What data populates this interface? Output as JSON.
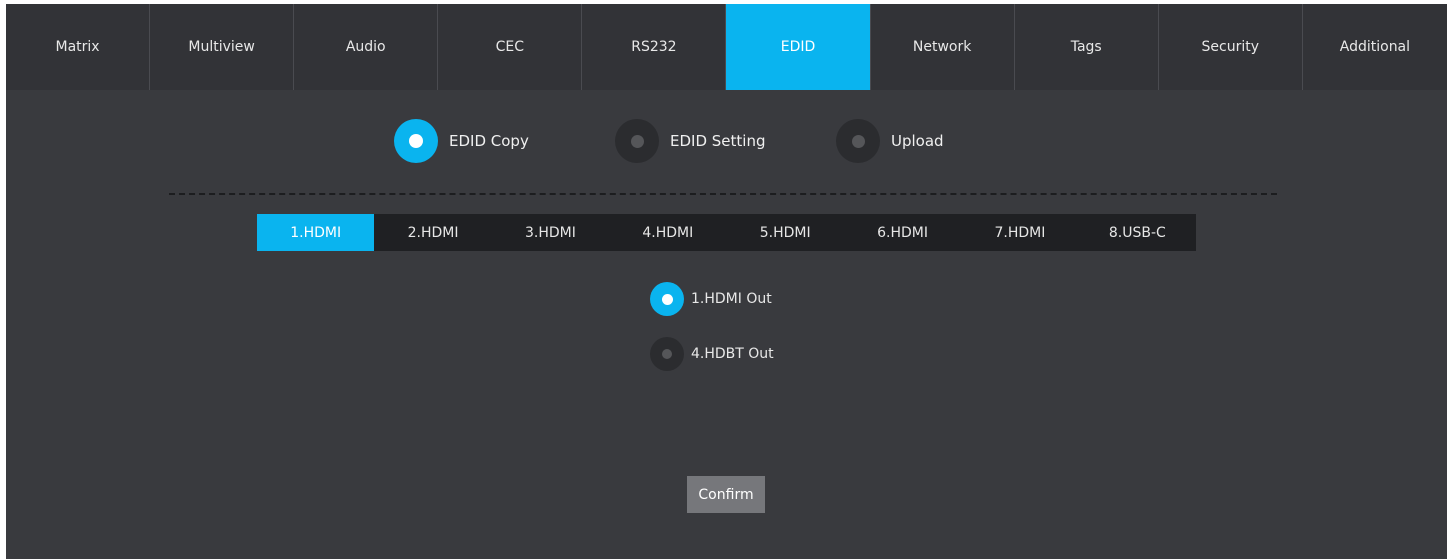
{
  "nav": {
    "tabs": [
      {
        "label": "Matrix"
      },
      {
        "label": "Multiview"
      },
      {
        "label": "Audio"
      },
      {
        "label": "CEC"
      },
      {
        "label": "RS232"
      },
      {
        "label": "EDID"
      },
      {
        "label": "Network"
      },
      {
        "label": "Tags"
      },
      {
        "label": "Security"
      },
      {
        "label": "Additional"
      }
    ],
    "active": "EDID"
  },
  "modes": [
    {
      "label": "EDID Copy",
      "selected": true
    },
    {
      "label": "EDID Setting",
      "selected": false
    },
    {
      "label": "Upload",
      "selected": false
    }
  ],
  "inputs": {
    "tabs": [
      {
        "label": "1.HDMI"
      },
      {
        "label": "2.HDMI"
      },
      {
        "label": "3.HDMI"
      },
      {
        "label": "4.HDMI"
      },
      {
        "label": "5.HDMI"
      },
      {
        "label": "6.HDMI"
      },
      {
        "label": "7.HDMI"
      },
      {
        "label": "8.USB-C"
      }
    ],
    "active": "1.HDMI"
  },
  "outputs": [
    {
      "label": "1.HDMI Out",
      "selected": true
    },
    {
      "label": "4.HDBT Out",
      "selected": false
    }
  ],
  "confirm_label": "Confirm",
  "colors": {
    "accent": "#0ab4ef",
    "background": "#393a3e",
    "nav_background": "#323337"
  }
}
